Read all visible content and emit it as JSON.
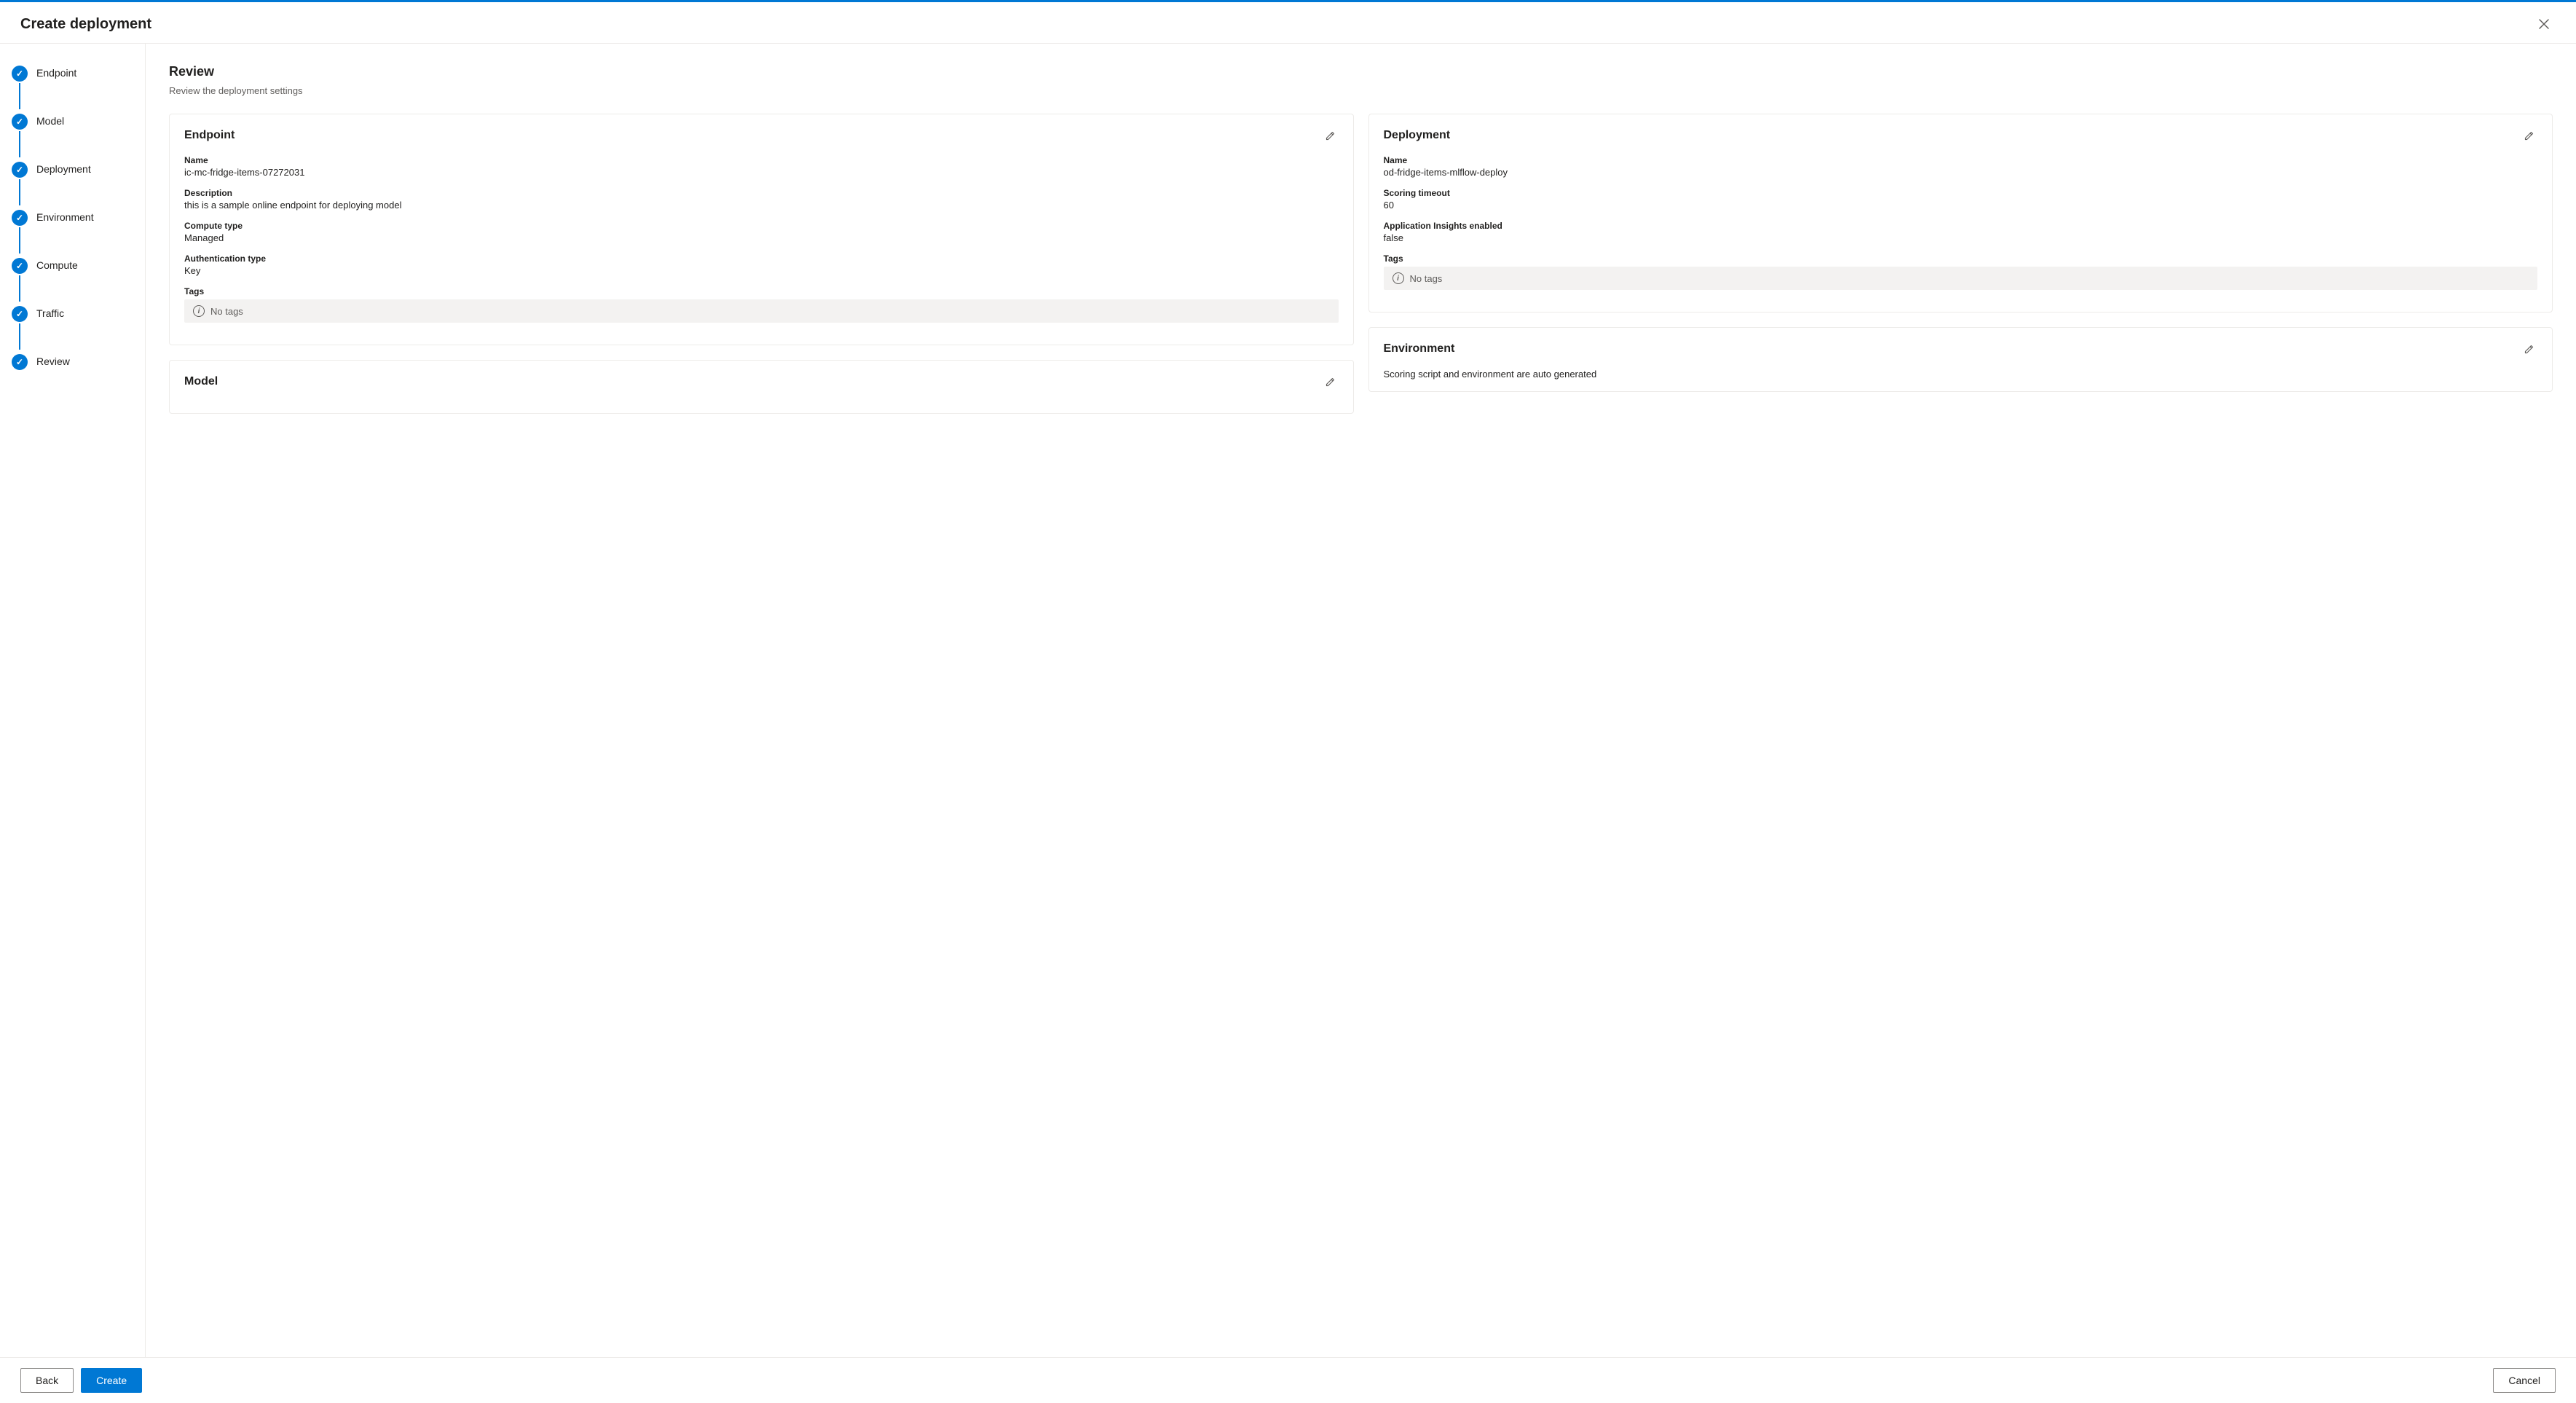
{
  "dialog": {
    "title": "Create deployment",
    "close_label": "×"
  },
  "steps": [
    {
      "id": "endpoint",
      "label": "Endpoint",
      "completed": true
    },
    {
      "id": "model",
      "label": "Model",
      "completed": true
    },
    {
      "id": "deployment",
      "label": "Deployment",
      "completed": true
    },
    {
      "id": "environment",
      "label": "Environment",
      "completed": true
    },
    {
      "id": "compute",
      "label": "Compute",
      "completed": true
    },
    {
      "id": "traffic",
      "label": "Traffic",
      "completed": true
    },
    {
      "id": "review",
      "label": "Review",
      "completed": true
    }
  ],
  "review": {
    "title": "Review",
    "subtitle": "Review the deployment settings"
  },
  "endpoint_card": {
    "title": "Endpoint",
    "fields": [
      {
        "label": "Name",
        "value": "ic-mc-fridge-items-07272031"
      },
      {
        "label": "Description",
        "value": "this is a sample online endpoint for deploying model"
      },
      {
        "label": "Compute type",
        "value": "Managed"
      },
      {
        "label": "Authentication type",
        "value": "Key"
      }
    ],
    "tags_label": "Tags",
    "tags_value": "No tags"
  },
  "deployment_card": {
    "title": "Deployment",
    "fields": [
      {
        "label": "Name",
        "value": "od-fridge-items-mlflow-deploy"
      },
      {
        "label": "Scoring timeout",
        "value": "60"
      },
      {
        "label": "Application Insights enabled",
        "value": "false"
      }
    ],
    "tags_label": "Tags",
    "tags_value": "No tags"
  },
  "environment_card": {
    "title": "Environment",
    "subtitle": "Scoring script and environment are auto generated"
  },
  "model_card": {
    "title": "Model"
  },
  "footer": {
    "back_label": "Back",
    "create_label": "Create",
    "cancel_label": "Cancel"
  }
}
